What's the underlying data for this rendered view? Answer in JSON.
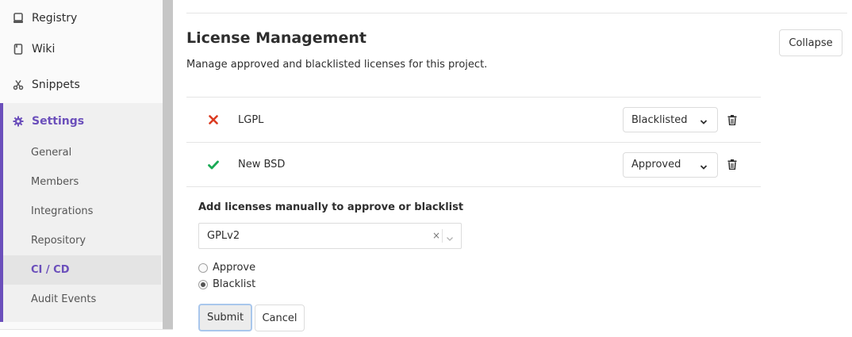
{
  "sidebar": {
    "items": [
      {
        "label": "Registry",
        "icon": "registry-icon"
      },
      {
        "label": "Wiki",
        "icon": "book-icon"
      },
      {
        "label": "Snippets",
        "icon": "scissors-icon"
      },
      {
        "label": "Settings",
        "icon": "gear-icon"
      }
    ],
    "settings_sub": [
      {
        "label": "General"
      },
      {
        "label": "Members"
      },
      {
        "label": "Integrations"
      },
      {
        "label": "Repository"
      },
      {
        "label": "CI / CD",
        "active": true
      },
      {
        "label": "Audit Events"
      }
    ],
    "accent_color": "#6b4fbb"
  },
  "main": {
    "title": "License Management",
    "description": "Manage approved and blacklisted licenses for this project.",
    "collapse_label": "Collapse",
    "licenses": [
      {
        "name": "LGPL",
        "status": "Blacklisted",
        "icon": "cross-icon",
        "icon_color": "#db3b21"
      },
      {
        "name": "New BSD",
        "status": "Approved",
        "icon": "check-icon",
        "icon_color": "#1aaa55"
      }
    ],
    "add_form": {
      "title": "Add licenses manually to approve or blacklist",
      "license_value": "GPLv2",
      "clear_glyph": "×",
      "options": [
        {
          "label": "Approve",
          "checked": false
        },
        {
          "label": "Blacklist",
          "checked": true
        }
      ],
      "submit_label": "Submit",
      "cancel_label": "Cancel"
    }
  }
}
